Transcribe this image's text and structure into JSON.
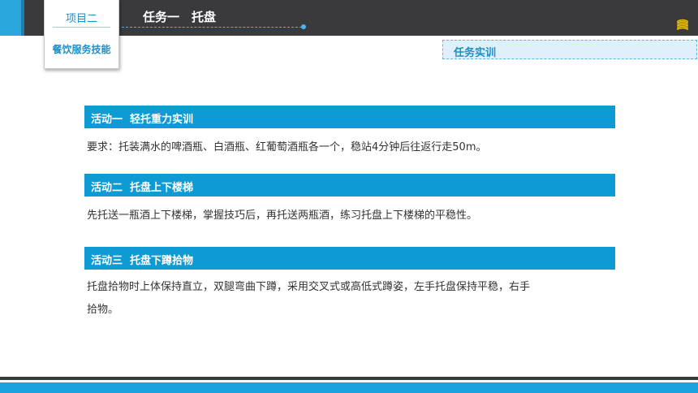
{
  "header": {
    "project_label": "项目二",
    "project_subtitle": "餐饮服务技能",
    "task_title": "任务一　托盘"
  },
  "section_tag": "任务实训",
  "activities": [
    {
      "title": "活动一  轻托重力实训",
      "text": "要求：托装满水的啤酒瓶、白酒瓶、红葡萄酒瓶各一个，稳站4分钟后往返行走50m。"
    },
    {
      "title": "活动二  托盘上下楼梯",
      "text": "先托送一瓶酒上下楼梯，掌握技巧后，再托送两瓶酒，练习托盘上下楼梯的平稳性。"
    },
    {
      "title": "活动三  托盘下蹲拾物",
      "text": "托盘拾物时上体保持直立，双腿弯曲下蹲，采用交叉式或高低式蹲姿，左手托盘保持平稳，右手拾物。"
    }
  ],
  "colors": {
    "accent_blue": "#0e9bd4",
    "dark_bar": "#3a3a3c",
    "tag_bg": "#dff0fb"
  },
  "icons": {
    "logo": "book-stack-icon"
  }
}
